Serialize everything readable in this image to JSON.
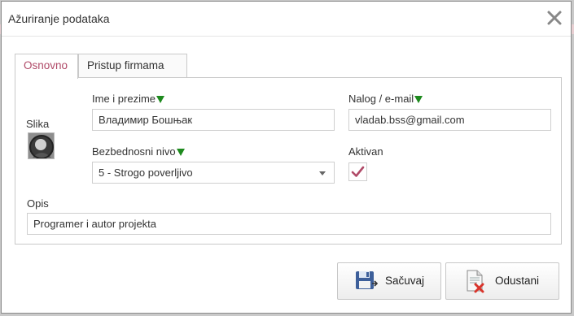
{
  "dialog": {
    "title": "Ažuriranje podataka"
  },
  "tabs": [
    {
      "label": "Osnovno",
      "active": true
    },
    {
      "label": "Pristup firmama",
      "active": false
    }
  ],
  "form": {
    "photo_label": "Slika",
    "name_label": "Ime i prezime",
    "name_value": "Владимир Бошњак",
    "account_label": "Nalog / e-mail",
    "account_value": "vladab.bss@gmail.com",
    "security_label": "Bezbednosni nivo",
    "security_value": "5 - Strogo poverljivo",
    "active_label": "Aktivan",
    "active_checked": true,
    "description_label": "Opis",
    "description_value": "Programer i autor projekta"
  },
  "buttons": {
    "save_label": "Sačuvaj",
    "cancel_label": "Odustani"
  },
  "colors": {
    "active_tab": "#b04a68",
    "required_marker": "#1e8a1e",
    "checkmark": "#b04a68"
  }
}
